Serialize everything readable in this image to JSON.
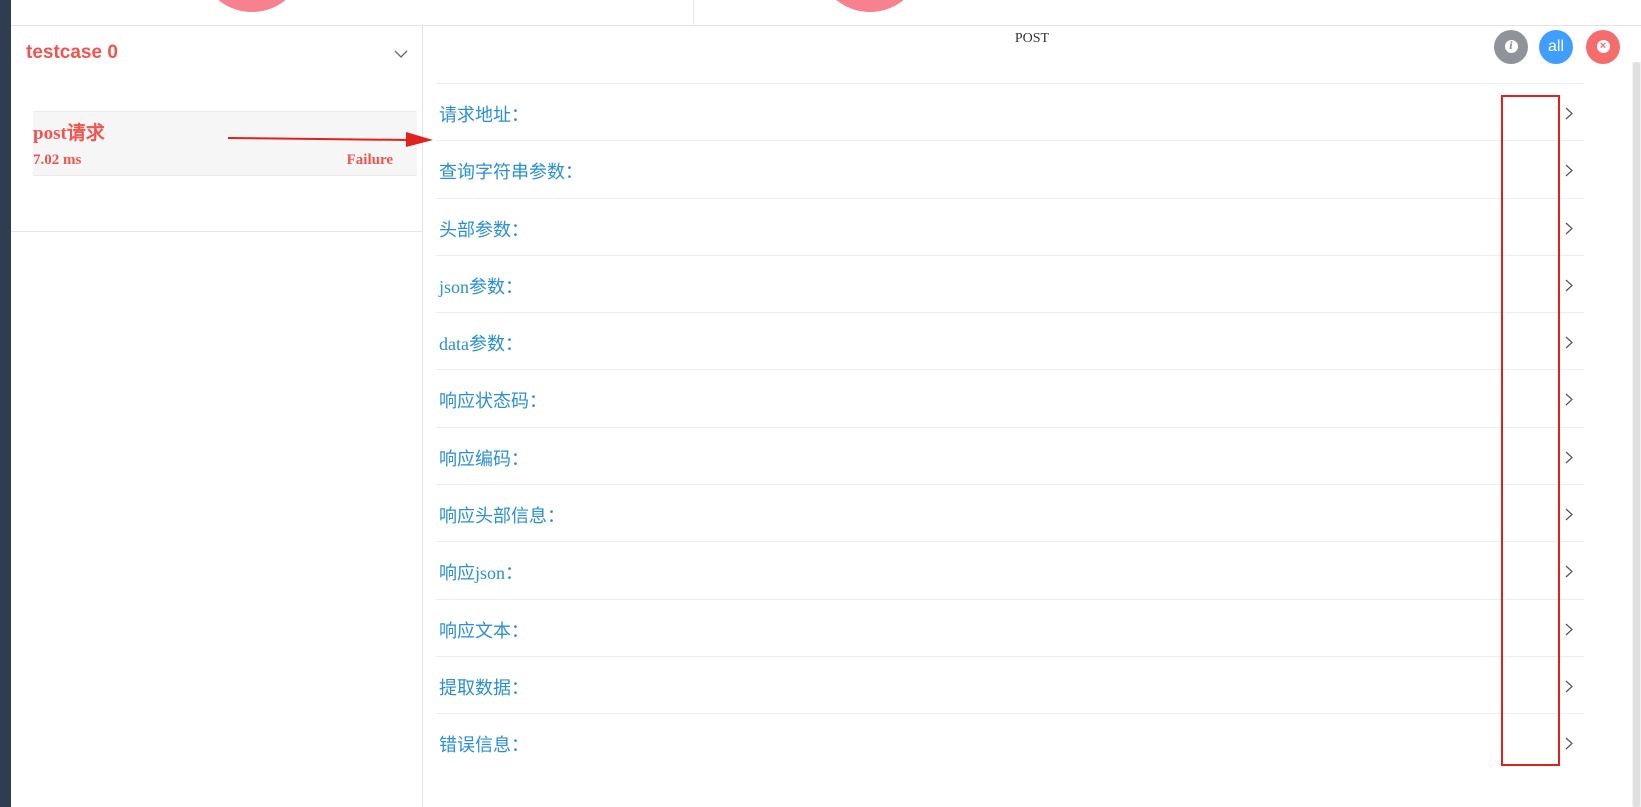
{
  "sidebar": {
    "case_title": "testcase 0",
    "item": {
      "name": "post请求",
      "time": "7.02 ms",
      "status": "Failure"
    }
  },
  "main": {
    "method": "POST",
    "buttons": {
      "info_icon": "info-icon",
      "all_label": "all",
      "close_icon": "close-icon"
    },
    "sections": [
      {
        "label": "请求地址："
      },
      {
        "label": "查询字符串参数："
      },
      {
        "label": "头部参数："
      },
      {
        "label": "json参数："
      },
      {
        "label": "data参数："
      },
      {
        "label": "响应状态码："
      },
      {
        "label": "响应编码："
      },
      {
        "label": "响应头部信息："
      },
      {
        "label": "响应json："
      },
      {
        "label": "响应文本："
      },
      {
        "label": "提取数据："
      },
      {
        "label": "错误信息："
      }
    ]
  },
  "colors": {
    "failure_red": "#f2544f",
    "section_blue": "#2a8fd6",
    "info_gray": "#909399",
    "all_blue": "#409eff",
    "close_red": "#f56c6c",
    "annotation_red": "#e0221c"
  }
}
